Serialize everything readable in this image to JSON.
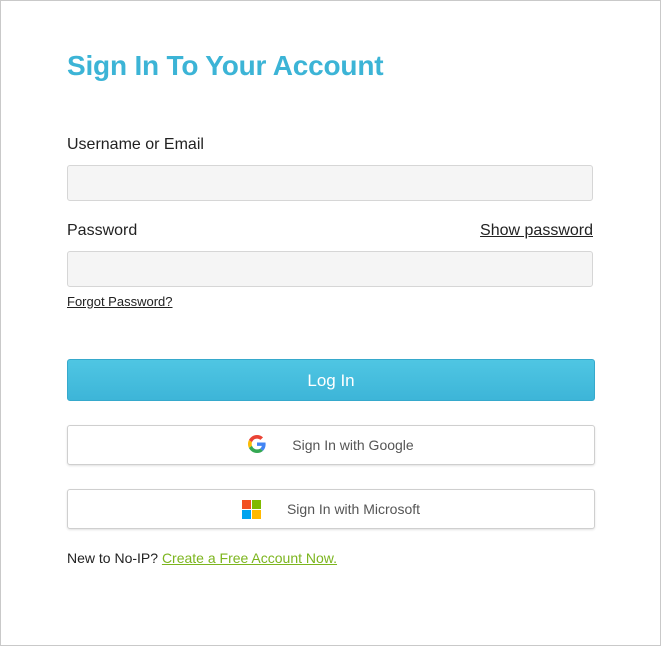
{
  "title": "Sign In To Your Account",
  "username": {
    "label": "Username or Email",
    "value": "",
    "placeholder": ""
  },
  "password": {
    "label": "Password",
    "value": "",
    "placeholder": "",
    "show_label": "Show password"
  },
  "forgot_label": "Forgot Password?",
  "login_label": "Log In",
  "google": {
    "label": "Sign In with Google",
    "icon": "google-icon"
  },
  "microsoft": {
    "label": "Sign In with Microsoft",
    "icon": "microsoft-icon"
  },
  "footer": {
    "text": "New to No-IP? ",
    "link": "Create a Free Account Now."
  },
  "colors": {
    "title": "#3cb4d6",
    "login_button": "#45bddd",
    "link_green": "#7cb51e",
    "input_bg": "#f5f5f5"
  }
}
